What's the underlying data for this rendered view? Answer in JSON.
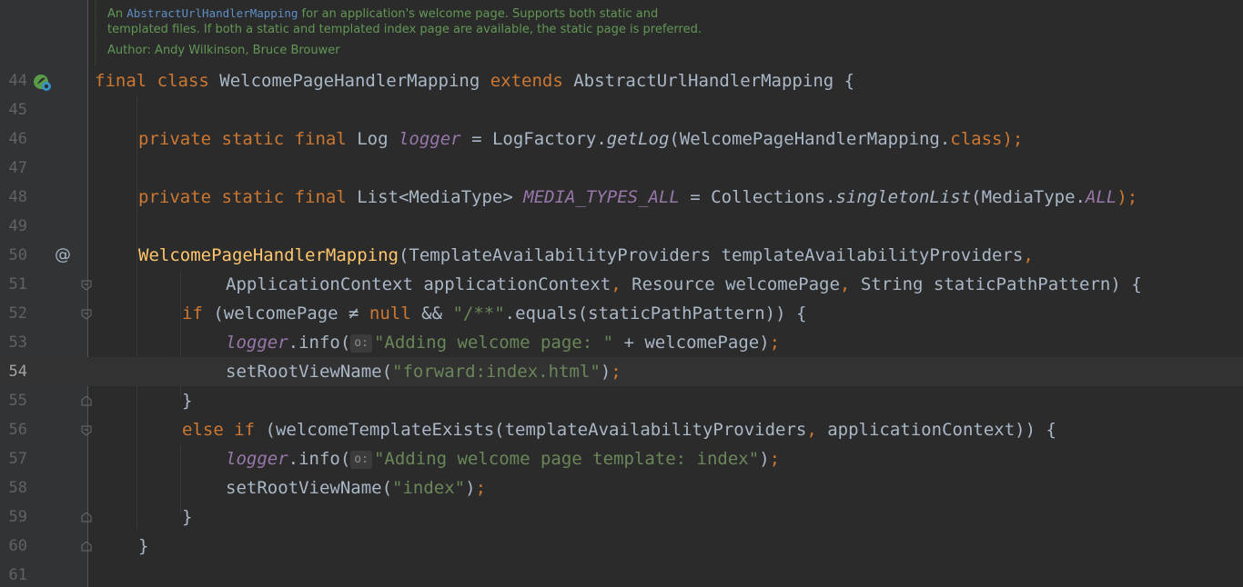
{
  "doc_comment": {
    "line1_prefix": "An ",
    "line1_code": "AbstractUrlHandlerMapping",
    "line1_suffix": " for an application's welcome page. Supports both static and",
    "line2": "templated files. If both a static and templated index page are available, the static page is preferred.",
    "author": "Author: Andy Wilkinson, Bruce Brouwer"
  },
  "lines": [
    {
      "num": "44"
    },
    {
      "num": "45"
    },
    {
      "num": "46"
    },
    {
      "num": "47"
    },
    {
      "num": "48"
    },
    {
      "num": "49"
    },
    {
      "num": "50"
    },
    {
      "num": "51"
    },
    {
      "num": "52"
    },
    {
      "num": "53"
    },
    {
      "num": "54"
    },
    {
      "num": "55"
    },
    {
      "num": "56"
    },
    {
      "num": "57"
    },
    {
      "num": "58"
    },
    {
      "num": "59"
    },
    {
      "num": "60"
    },
    {
      "num": "61"
    }
  ],
  "code": {
    "l44": {
      "t1": "final class ",
      "t2": "WelcomePageHandlerMapping ",
      "t3": "extends ",
      "t4": "AbstractUrlHandlerMapping {"
    },
    "l46": {
      "t1": "private static final ",
      "t2": "Log ",
      "t3": "logger",
      "t4": " = LogFactory.",
      "t5": "getLog",
      "t6": "(WelcomePageHandlerMapping.",
      "t7": "class",
      "t8": ");"
    },
    "l48": {
      "t1": "private static final ",
      "t2": "List<MediaType> ",
      "t3": "MEDIA_TYPES_ALL",
      "t4": " = Collections.",
      "t5": "singletonList",
      "t6": "(MediaType.",
      "t7": "ALL",
      "t8": ");"
    },
    "l50": {
      "t1": "WelcomePageHandlerMapping",
      "t2": "(TemplateAvailabilityProviders templateAvailabilityProviders",
      "t3": ","
    },
    "l51": {
      "t1": "ApplicationContext applicationContext",
      "t2": ", ",
      "t3": "Resource welcomePage",
      "t4": ", ",
      "t5": "String staticPathPattern) {"
    },
    "l52": {
      "t1": "if ",
      "t2": "(welcomePage ≠ ",
      "t3": "null ",
      "t4": "&& ",
      "t5": "\"/**\"",
      "t6": ".equals(staticPathPattern)) {"
    },
    "l53": {
      "t1": "logger",
      "t2": ".info(",
      "hint": "o:",
      "t3": "\"Adding welcome page: \" ",
      "t4": "+ welcomePage)",
      "t5": ";"
    },
    "l54": {
      "t1": "setRootViewName(",
      "t2": "\"forward:index.html\"",
      "t3": ")",
      "t4": ";"
    },
    "l55": {
      "t1": "}"
    },
    "l56": {
      "t1": "else if ",
      "t2": "(welcomeTemplateExists(templateAvailabilityProviders",
      "t3": ", ",
      "t4": "applicationContext)) {"
    },
    "l57": {
      "t1": "logger",
      "t2": ".info(",
      "hint": "o:",
      "t3": "\"Adding welcome page template: index\"",
      "t4": ")",
      "t5": ";"
    },
    "l58": {
      "t1": "setRootViewName(",
      "t2": "\"index\"",
      "t3": ")",
      "t4": ";"
    },
    "l59": {
      "t1": "}"
    },
    "l60": {
      "t1": "}"
    }
  },
  "gutter": {
    "override_marker": "@"
  },
  "colors": {
    "background": "#2b2b2b",
    "gutter": "#313335",
    "keyword": "#cc7832",
    "function": "#ffc66d",
    "string": "#6a8759",
    "field": "#9876aa",
    "text": "#a9b7c6",
    "doc": "#629755"
  }
}
